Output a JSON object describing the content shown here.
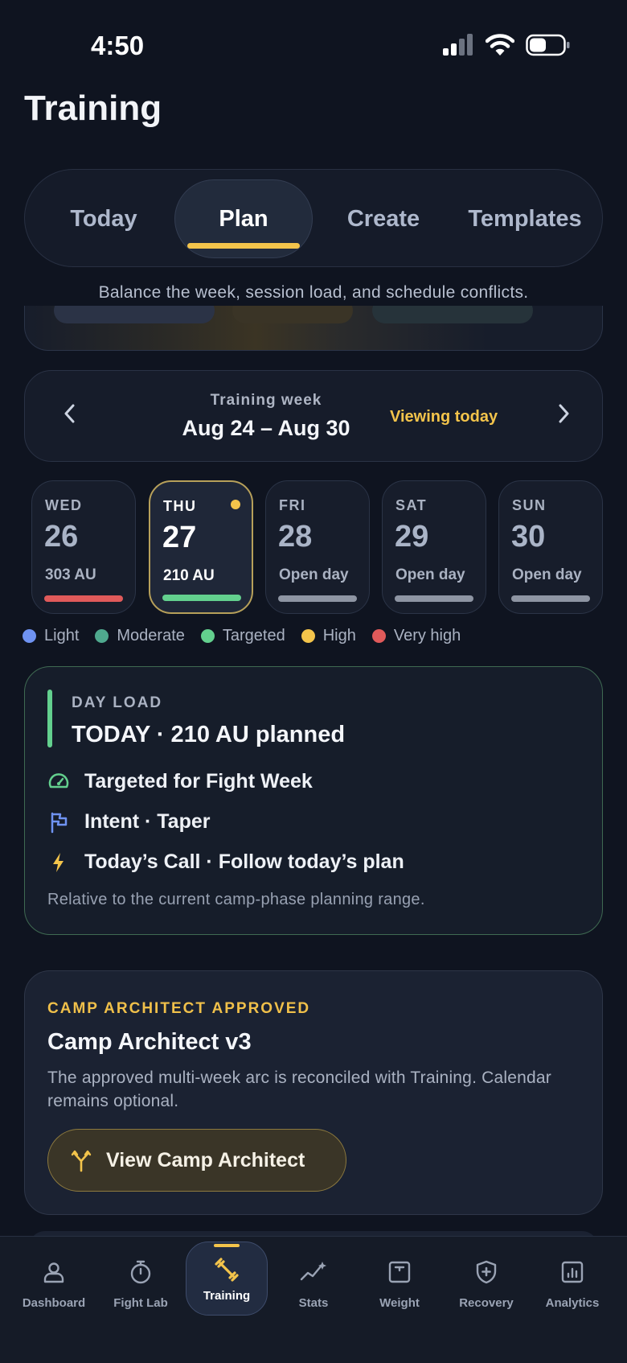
{
  "status": {
    "time": "4:50"
  },
  "page": {
    "title": "Training"
  },
  "tabs": [
    {
      "label": "Today"
    },
    {
      "label": "Plan"
    },
    {
      "label": "Create"
    },
    {
      "label": "Templates"
    }
  ],
  "subtitle": "Balance the week, session load, and schedule conflicts.",
  "week": {
    "label": "Training week",
    "range": "Aug 24 – Aug 30",
    "viewing": "Viewing today"
  },
  "days": [
    {
      "abbr": "WED",
      "num": "26",
      "load": "303 AU",
      "bar_color": "#e05a5a"
    },
    {
      "abbr": "THU",
      "num": "27",
      "load": "210 AU",
      "bar_color": "#63d08e"
    },
    {
      "abbr": "FRI",
      "num": "28",
      "load": "Open day",
      "bar_color": "#8e95a3"
    },
    {
      "abbr": "SAT",
      "num": "29",
      "load": "Open day",
      "bar_color": "#8e95a3"
    },
    {
      "abbr": "SUN",
      "num": "30",
      "load": "Open day",
      "bar_color": "#8e95a3"
    }
  ],
  "legend": [
    {
      "label": "Light",
      "color": "#6f93f2"
    },
    {
      "label": "Moderate",
      "color": "#4fa98e"
    },
    {
      "label": "Targeted",
      "color": "#63d08e"
    },
    {
      "label": "High",
      "color": "#f3c44b"
    },
    {
      "label": "Very high",
      "color": "#e05a5a"
    }
  ],
  "day_load": {
    "eyebrow": "DAY LOAD",
    "title": "TODAY · 210 AU planned",
    "rows": [
      {
        "icon": "gauge-icon",
        "text": "Targeted for Fight Week"
      },
      {
        "icon": "flag-icon",
        "text": "Intent · Taper"
      },
      {
        "icon": "lightning-icon",
        "text": "Today’s Call · Follow today’s plan"
      }
    ],
    "note": "Relative to the current camp-phase planning range."
  },
  "camp": {
    "eyebrow": "CAMP ARCHITECT APPROVED",
    "title": "Camp Architect v3",
    "description": "The approved multi-week arc is reconciled with Training. Calendar remains optional.",
    "button": "View Camp Architect"
  },
  "nav": [
    {
      "label": "Dashboard",
      "icon": "person-icon"
    },
    {
      "label": "Fight Lab",
      "icon": "stopwatch-icon"
    },
    {
      "label": "Training",
      "icon": "dumbbell-icon"
    },
    {
      "label": "Stats",
      "icon": "sparkline-icon"
    },
    {
      "label": "Weight",
      "icon": "scale-icon"
    },
    {
      "label": "Recovery",
      "icon": "shield-plus-icon"
    },
    {
      "label": "Analytics",
      "icon": "bar-chart-icon"
    }
  ],
  "colors": {
    "accent": "#f3c44b",
    "targeted": "#63d08e",
    "background": "#0f1420"
  }
}
